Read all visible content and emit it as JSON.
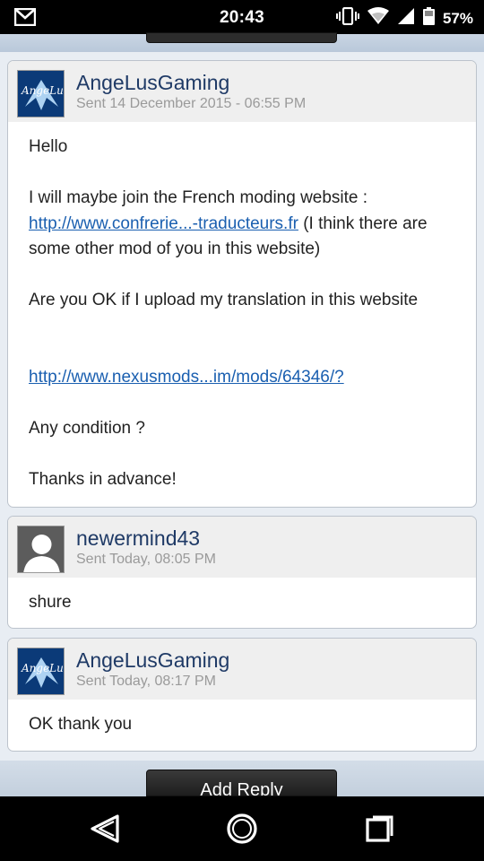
{
  "status_bar": {
    "time": "20:43",
    "battery": "57%",
    "icons": [
      "gmail-icon",
      "vibrate-icon",
      "wifi-icon",
      "signal-icon",
      "battery-icon"
    ]
  },
  "messages": [
    {
      "sender": "AngeLusGaming",
      "sent": "Sent 14 December 2015 - 06:55 PM",
      "avatar": "angelus-avatar",
      "body": {
        "greeting": "Hello",
        "line1_text": "I will maybe join the French moding website :",
        "link1": "http://www.confrerie...-traducteurs.fr",
        "line1_after": " (I think there are some other mod of you in this website)",
        "question": "Are you OK if I upload my translation in this website",
        "link2": "http://www.nexusmods...im/mods/64346/?",
        "condition": "Any condition ?",
        "thanks": "Thanks in advance!"
      }
    },
    {
      "sender": "newermind43",
      "sent": "Sent Today, 08:05 PM",
      "avatar": "default-user-avatar",
      "body": {
        "text": "shure"
      }
    },
    {
      "sender": "AngeLusGaming",
      "sent": "Sent Today, 08:17 PM",
      "avatar": "angelus-avatar",
      "body": {
        "text": "OK thank you"
      }
    }
  ],
  "reply_button": "Add Reply",
  "nav": {
    "back": "back-icon",
    "home": "home-icon",
    "recents": "recents-icon"
  },
  "colors": {
    "sender": "#1f3a66",
    "link": "#1a5fb0",
    "header_bg": "#efefef"
  }
}
